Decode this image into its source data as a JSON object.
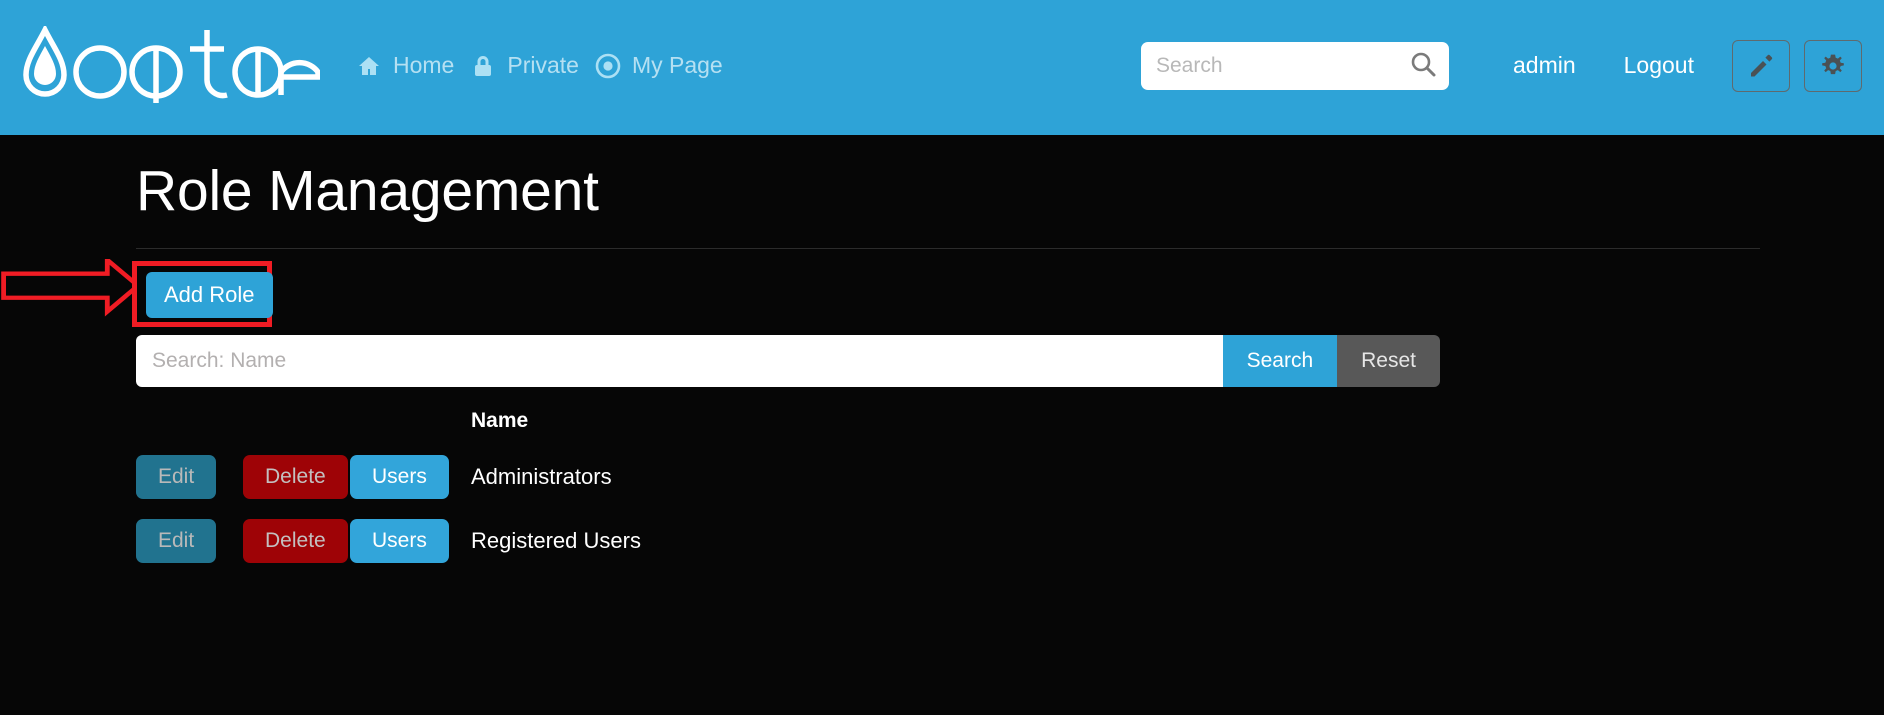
{
  "colors": {
    "brand_blue": "#2EA3D7",
    "page_bg": "#060606",
    "button_primary": "#2EA3D7",
    "button_users": "#32A5DA",
    "button_edit": "#21738f",
    "button_delete": "#9e0306",
    "button_reset": "#585858",
    "annotation_red": "#f01c24",
    "nav_link": "#b5e0f2"
  },
  "header": {
    "brand_name": "oqtane",
    "brand_logo_icon": "water-drop-icon",
    "nav_items": [
      {
        "label": "Home",
        "icon": "home-icon"
      },
      {
        "label": "Private",
        "icon": "lock-icon"
      },
      {
        "label": "My Page",
        "icon": "target-circle-icon"
      }
    ],
    "search": {
      "value": "",
      "placeholder": "Search",
      "submit_icon": "search-icon"
    },
    "user": {
      "username": "admin",
      "logout_label": "Logout"
    },
    "actions": [
      {
        "name": "edit-page-button",
        "icon": "pencil-icon"
      },
      {
        "name": "settings-button",
        "icon": "gear-icon"
      }
    ]
  },
  "main": {
    "page_title": "Role Management",
    "add_role_label": "Add Role",
    "filter": {
      "value": "",
      "placeholder": "Search: Name",
      "search_label": "Search",
      "reset_label": "Reset"
    },
    "table": {
      "headers": [
        "",
        "",
        "",
        "Name"
      ],
      "name_header": "Name",
      "rows": [
        {
          "edit_label": "Edit",
          "delete_label": "Delete",
          "users_label": "Users",
          "name": "Administrators"
        },
        {
          "edit_label": "Edit",
          "delete_label": "Delete",
          "users_label": "Users",
          "name": "Registered Users"
        }
      ]
    }
  },
  "annotation": {
    "type": "arrow-highlight",
    "points_to": "Add Role",
    "color": "#f01c24"
  }
}
